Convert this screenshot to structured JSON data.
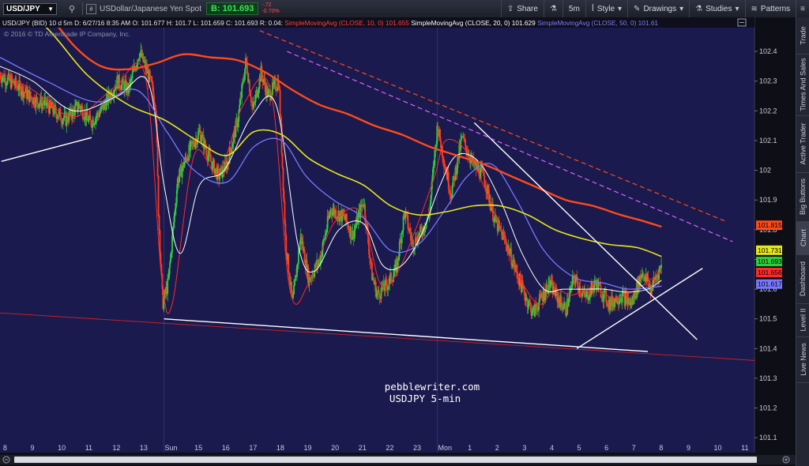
{
  "toolbar": {
    "symbol": "USD/JPY",
    "description": "USDollar/Japanese Yen Spot",
    "bid": "B: 101.693",
    "change": "-.72",
    "change_pct": "-0.70%",
    "buttons": [
      "Share",
      "5m",
      "Style",
      "Drawings",
      "Studies",
      "Patterns"
    ]
  },
  "info": {
    "line1_parts": [
      {
        "text": "USD/JPY (BID) 10 d 5m  D: 6/27/16 8:35 AM  O: 101.677  H: 101.7  L: 101.659  C: 101.693  R: 0.04:",
        "color": "#e6e8ef"
      },
      {
        "text": "SimpleMovingAvg (CLOSE, 10, 0)",
        "color": "#ff4040"
      },
      {
        "text": " 101.655 ",
        "color": "#ff4040"
      },
      {
        "text": "SimpleMovingAvg (CLOSE, 20, 0)",
        "color": "#ffffff"
      },
      {
        "text": " 101.629 ",
        "color": "#ffffff"
      },
      {
        "text": "SimpleMovingAvg (CLOSE, 50, 0)",
        "color": "#7d7dff"
      },
      {
        "text": " 101.61",
        "color": "#7d7dff"
      }
    ],
    "copyright": "© 2016 © TD Ameritrade IP Company, Inc."
  },
  "watermark": {
    "line1": "pebblewriter.com",
    "line2": "USDJPY 5-min"
  },
  "right_tabs": [
    "Trade",
    "Times And Sales",
    "Active Trader",
    "Big Buttons",
    "Chart",
    "Dashboard",
    "Level II",
    "Live News"
  ],
  "active_tab": "Chart",
  "colors": {
    "bg": "#1a1a4e",
    "up": "#2fcf3a",
    "down": "#ff3b1f",
    "sma10": "#ff2a2a",
    "sma20": "#ffffff",
    "sma50": "#7777ff",
    "sma100": "#e6e619",
    "sma200": "#ff4a1a"
  },
  "chart_data": {
    "type": "candlestick",
    "ylim": [
      101.05,
      102.48
    ],
    "y_ticks": [
      102.4,
      102.3,
      102.2,
      102.1,
      102,
      101.9,
      101.8,
      101.7,
      101.6,
      101.5,
      101.4,
      101.3,
      101.2,
      101.1
    ],
    "x_labels": [
      {
        "label": "8",
        "x": 0.5
      },
      {
        "label": "9",
        "x": 1.5
      },
      {
        "label": "10",
        "x": 2.5
      },
      {
        "label": "11",
        "x": 3.5
      },
      {
        "label": "12",
        "x": 4.5
      },
      {
        "label": "13",
        "x": 5.5
      },
      {
        "label": "Sun",
        "x": 6.5
      },
      {
        "label": "15",
        "x": 7.5
      },
      {
        "label": "16",
        "x": 8.5
      },
      {
        "label": "17",
        "x": 9.5
      },
      {
        "label": "18",
        "x": 10.5
      },
      {
        "label": "19",
        "x": 11.5
      },
      {
        "label": "20",
        "x": 12.5
      },
      {
        "label": "21",
        "x": 13.5
      },
      {
        "label": "22",
        "x": 14.5
      },
      {
        "label": "23",
        "x": 15.5
      },
      {
        "label": "Mon",
        "x": 16.5
      },
      {
        "label": "1",
        "x": 17.5
      },
      {
        "label": "2",
        "x": 18.5
      },
      {
        "label": "3",
        "x": 19.5
      },
      {
        "label": "4",
        "x": 20.5
      },
      {
        "label": "5",
        "x": 21.5
      },
      {
        "label": "6",
        "x": 22.5
      },
      {
        "label": "7",
        "x": 23.5
      },
      {
        "label": "8",
        "x": 24.5
      },
      {
        "label": "9",
        "x": 25.5
      },
      {
        "label": "10",
        "x": 26.5
      },
      {
        "label": "11",
        "x": 27.5
      }
    ],
    "xlim": [
      0.3,
      27.9
    ],
    "session_breaks": [
      6.3,
      16.3
    ],
    "price_path": [
      [
        0.3,
        102.32
      ],
      [
        1.0,
        102.28
      ],
      [
        1.5,
        102.24
      ],
      [
        2.0,
        102.22
      ],
      [
        2.7,
        102.17
      ],
      [
        3.2,
        102.22
      ],
      [
        3.6,
        102.16
      ],
      [
        4.0,
        102.2
      ],
      [
        4.6,
        102.3
      ],
      [
        5.0,
        102.27
      ],
      [
        5.4,
        102.4
      ],
      [
        5.8,
        102.3
      ],
      [
        6.0,
        102.22
      ],
      [
        6.1,
        101.85
      ],
      [
        6.25,
        101.55
      ],
      [
        6.45,
        101.62
      ],
      [
        6.8,
        101.97
      ],
      [
        7.2,
        102.06
      ],
      [
        7.6,
        102.13
      ],
      [
        8.0,
        102.03
      ],
      [
        8.3,
        101.98
      ],
      [
        8.6,
        102.02
      ],
      [
        9.0,
        102.17
      ],
      [
        9.3,
        102.37
      ],
      [
        9.55,
        102.2
      ],
      [
        9.85,
        102.33
      ],
      [
        10.1,
        102.25
      ],
      [
        10.5,
        102.3
      ],
      [
        10.75,
        101.76
      ],
      [
        11.0,
        101.55
      ],
      [
        11.3,
        101.78
      ],
      [
        11.6,
        101.63
      ],
      [
        12.0,
        101.7
      ],
      [
        12.4,
        101.87
      ],
      [
        12.9,
        101.84
      ],
      [
        13.2,
        101.78
      ],
      [
        13.6,
        101.9
      ],
      [
        13.9,
        101.65
      ],
      [
        14.1,
        101.58
      ],
      [
        14.5,
        101.62
      ],
      [
        14.8,
        101.67
      ],
      [
        15.1,
        101.86
      ],
      [
        15.4,
        101.75
      ],
      [
        15.7,
        101.79
      ],
      [
        16.0,
        101.85
      ],
      [
        16.3,
        102.15
      ],
      [
        16.55,
        102.03
      ],
      [
        16.8,
        101.92
      ],
      [
        17.2,
        102.11
      ],
      [
        17.6,
        102.02
      ],
      [
        18.0,
        101.98
      ],
      [
        18.4,
        101.83
      ],
      [
        18.8,
        101.76
      ],
      [
        19.1,
        101.68
      ],
      [
        19.5,
        101.58
      ],
      [
        19.8,
        101.52
      ],
      [
        20.1,
        101.57
      ],
      [
        20.4,
        101.62
      ],
      [
        20.7,
        101.57
      ],
      [
        21.0,
        101.53
      ],
      [
        21.3,
        101.64
      ],
      [
        21.7,
        101.57
      ],
      [
        22.1,
        101.62
      ],
      [
        22.6,
        101.55
      ],
      [
        23.0,
        101.58
      ],
      [
        23.4,
        101.55
      ],
      [
        23.8,
        101.66
      ],
      [
        24.1,
        101.6
      ],
      [
        24.5,
        101.68
      ]
    ],
    "series": [
      {
        "name": "SimpleMovingAvg (CLOSE, 10, 0)",
        "key": "sma10",
        "points": [
          [
            0.3,
            102.33
          ],
          [
            1.5,
            102.27
          ],
          [
            3.0,
            102.18
          ],
          [
            4.5,
            102.28
          ],
          [
            5.6,
            102.32
          ],
          [
            6.2,
            101.65
          ],
          [
            6.6,
            101.55
          ],
          [
            7.4,
            102.05
          ],
          [
            8.3,
            101.99
          ],
          [
            9.2,
            102.22
          ],
          [
            10.2,
            102.27
          ],
          [
            10.9,
            101.6
          ],
          [
            11.6,
            101.62
          ],
          [
            12.5,
            101.82
          ],
          [
            13.5,
            101.86
          ],
          [
            14.2,
            101.62
          ],
          [
            14.8,
            101.65
          ],
          [
            15.5,
            101.8
          ],
          [
            16.2,
            101.98
          ],
          [
            16.6,
            102.1
          ],
          [
            17.4,
            102.06
          ],
          [
            18.2,
            101.9
          ],
          [
            19.2,
            101.66
          ],
          [
            20.0,
            101.55
          ],
          [
            20.6,
            101.6
          ],
          [
            21.2,
            101.58
          ],
          [
            22.0,
            101.6
          ],
          [
            22.8,
            101.57
          ],
          [
            23.6,
            101.6
          ],
          [
            24.5,
            101.66
          ]
        ]
      },
      {
        "name": "SimpleMovingAvg (CLOSE, 20, 0)",
        "key": "sma20",
        "points": [
          [
            0.3,
            102.35
          ],
          [
            1.5,
            102.3
          ],
          [
            3.0,
            102.2
          ],
          [
            4.6,
            102.25
          ],
          [
            5.7,
            102.3
          ],
          [
            6.3,
            101.95
          ],
          [
            6.9,
            101.72
          ],
          [
            7.6,
            101.95
          ],
          [
            8.5,
            102.0
          ],
          [
            9.5,
            102.18
          ],
          [
            10.4,
            102.22
          ],
          [
            11.2,
            101.75
          ],
          [
            11.8,
            101.66
          ],
          [
            12.7,
            101.8
          ],
          [
            13.6,
            101.82
          ],
          [
            14.3,
            101.68
          ],
          [
            15.0,
            101.68
          ],
          [
            15.7,
            101.78
          ],
          [
            16.4,
            101.95
          ],
          [
            17.0,
            102.05
          ],
          [
            17.8,
            102.03
          ],
          [
            18.6,
            101.9
          ],
          [
            19.4,
            101.72
          ],
          [
            20.2,
            101.6
          ],
          [
            20.9,
            101.6
          ],
          [
            21.6,
            101.6
          ],
          [
            22.4,
            101.6
          ],
          [
            23.2,
            101.59
          ],
          [
            24.0,
            101.6
          ],
          [
            24.5,
            101.63
          ]
        ]
      },
      {
        "name": "SimpleMovingAvg (CLOSE, 50, 0)",
        "key": "sma50",
        "points": [
          [
            0.3,
            102.38
          ],
          [
            2.0,
            102.3
          ],
          [
            3.8,
            102.23
          ],
          [
            5.3,
            102.27
          ],
          [
            6.4,
            102.13
          ],
          [
            7.4,
            102.0
          ],
          [
            8.6,
            101.96
          ],
          [
            9.6,
            102.08
          ],
          [
            10.6,
            102.1
          ],
          [
            11.5,
            101.98
          ],
          [
            12.5,
            101.9
          ],
          [
            13.6,
            101.84
          ],
          [
            14.6,
            101.73
          ],
          [
            15.6,
            101.75
          ],
          [
            16.6,
            101.87
          ],
          [
            17.4,
            101.98
          ],
          [
            18.3,
            102.02
          ],
          [
            19.2,
            101.9
          ],
          [
            20.2,
            101.73
          ],
          [
            21.3,
            101.64
          ],
          [
            22.4,
            101.62
          ],
          [
            23.3,
            101.6
          ],
          [
            24.5,
            101.61
          ]
        ]
      },
      {
        "name": "SMA 100",
        "key": "sma100",
        "points": [
          [
            0.3,
            102.6
          ],
          [
            2.0,
            102.48
          ],
          [
            3.5,
            102.32
          ],
          [
            5.0,
            102.22
          ],
          [
            6.3,
            102.17
          ],
          [
            7.5,
            102.1
          ],
          [
            8.6,
            102.05
          ],
          [
            9.6,
            102.13
          ],
          [
            10.6,
            102.12
          ],
          [
            11.6,
            102.04
          ],
          [
            12.6,
            101.99
          ],
          [
            13.6,
            101.95
          ],
          [
            14.6,
            101.88
          ],
          [
            15.6,
            101.85
          ],
          [
            16.6,
            101.86
          ],
          [
            17.6,
            101.88
          ],
          [
            18.6,
            101.88
          ],
          [
            19.6,
            101.85
          ],
          [
            20.6,
            101.8
          ],
          [
            21.6,
            101.77
          ],
          [
            22.6,
            101.75
          ],
          [
            23.6,
            101.74
          ],
          [
            24.5,
            101.71
          ]
        ]
      },
      {
        "name": "SMA 200",
        "key": "sma200",
        "points": [
          [
            1.8,
            102.56
          ],
          [
            3.0,
            102.42
          ],
          [
            4.0,
            102.35
          ],
          [
            5.0,
            102.34
          ],
          [
            6.0,
            102.36
          ],
          [
            7.0,
            102.39
          ],
          [
            8.0,
            102.38
          ],
          [
            9.0,
            102.37
          ],
          [
            10.0,
            102.33
          ],
          [
            11.0,
            102.27
          ],
          [
            12.0,
            102.22
          ],
          [
            13.0,
            102.19
          ],
          [
            14.0,
            102.15
          ],
          [
            15.0,
            102.12
          ],
          [
            16.0,
            102.08
          ],
          [
            17.0,
            102.05
          ],
          [
            18.0,
            102.02
          ],
          [
            19.0,
            101.98
          ],
          [
            20.0,
            101.94
          ],
          [
            21.0,
            101.9
          ],
          [
            22.0,
            101.88
          ],
          [
            23.0,
            101.85
          ],
          [
            23.8,
            101.83
          ],
          [
            24.5,
            101.81
          ]
        ]
      }
    ],
    "drawings": [
      {
        "type": "trendline",
        "color": "#ffffff",
        "x1": 0.35,
        "y1": 102.03,
        "x2": 3.65,
        "y2": 102.11
      },
      {
        "type": "trendline",
        "color": "#ffffff",
        "x1": 6.3,
        "y1": 101.5,
        "x2": 24.0,
        "y2": 101.39
      },
      {
        "type": "trendline",
        "color": "#ffffff",
        "x1": 17.65,
        "y1": 102.16,
        "x2": 25.8,
        "y2": 101.43
      },
      {
        "type": "trendline",
        "color": "#ffffff",
        "x1": 21.4,
        "y1": 101.4,
        "x2": 26.0,
        "y2": 101.67
      },
      {
        "type": "trendline",
        "color": "#cc2222",
        "x1": 0.3,
        "y1": 101.52,
        "x2": 27.9,
        "y2": 101.36
      },
      {
        "type": "dashed",
        "color": "#ff4a1a",
        "x1": 9.8,
        "y1": 102.47,
        "x2": 26.8,
        "y2": 101.83
      },
      {
        "type": "dashed",
        "color": "#e060ff",
        "x1": 10.8,
        "y1": 102.4,
        "x2": 27.1,
        "y2": 101.76
      }
    ],
    "price_labels": [
      {
        "value": "101.815",
        "y": 101.815,
        "bg": "#ff4a1a",
        "fg": "#000000"
      },
      {
        "value": "101.731",
        "y": 101.731,
        "bg": "#e6e619",
        "fg": "#000000"
      },
      {
        "value": "101.693",
        "y": 101.693,
        "bg": "#2fcf3a",
        "fg": "#000000"
      },
      {
        "value": "101.656",
        "y": 101.656,
        "bg": "#ff2a2a",
        "fg": "#000000"
      },
      {
        "value": "101.617",
        "y": 101.617,
        "bg": "#7777ff",
        "fg": "#000000"
      }
    ]
  }
}
